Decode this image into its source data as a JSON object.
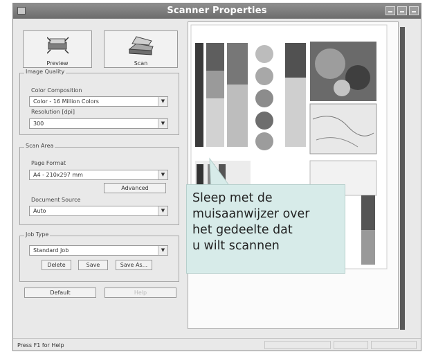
{
  "window": {
    "title": "Scanner Properties"
  },
  "toolbar": {
    "preview_label": "Preview",
    "scan_label": "Scan"
  },
  "image_quality": {
    "group_label": "Image Quality",
    "color_label": "Color Composition",
    "color_value": "Color - 16 Million Colors",
    "resolution_label": "Resolution [dpi]",
    "resolution_value": "300"
  },
  "scan_area": {
    "group_label": "Scan Area",
    "page_format_label": "Page Format",
    "page_format_value": "A4 - 210x297 mm",
    "advanced_label": "Advanced",
    "source_label": "Document Source",
    "source_value": "Auto"
  },
  "job_type": {
    "group_label": "Job Type",
    "value": "Standard Job",
    "delete_label": "Delete",
    "save_label": "Save",
    "save_as_label": "Save As..."
  },
  "footer": {
    "default_label": "Default",
    "help_label": "Help"
  },
  "callout": {
    "lines": [
      "Sleep met de",
      "muisaanwijzer over",
      "het gedeelte dat",
      "u wilt scannen"
    ]
  },
  "status": {
    "text": "Press F1 for Help"
  },
  "icons": {
    "preview": "preview-icon",
    "scan": "scanner-icon",
    "dropdown": "chevron-down-icon",
    "pointer": "mouse-pointer-icon"
  }
}
